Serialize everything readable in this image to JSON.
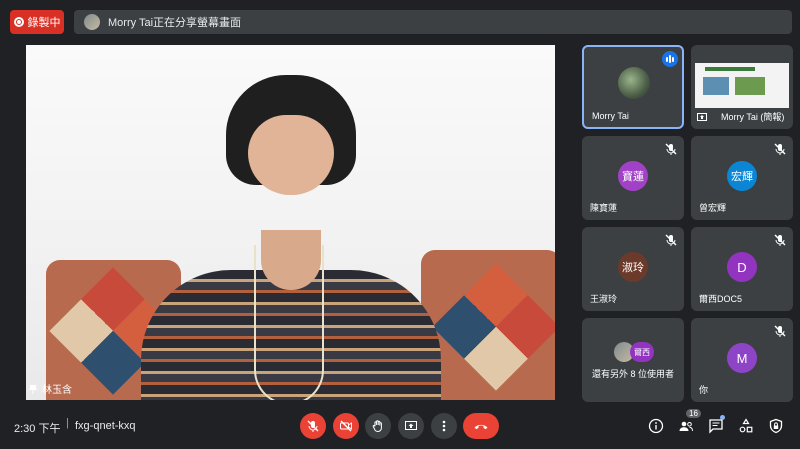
{
  "top_bar": {
    "recording_label": "錄製中",
    "share_text": "Morry Tai正在分享螢幕畫面"
  },
  "main_video": {
    "label": "林玉含"
  },
  "participants": [
    {
      "name": "Morry Tai",
      "kind": "video",
      "speaking": true
    },
    {
      "name": "Morry Tai (簡報)",
      "kind": "screen"
    },
    {
      "name": "陳寶蓮",
      "initial": "寶蓮",
      "color": "#a142c6",
      "muted": true
    },
    {
      "name": "曾宏輝",
      "initial": "宏輝",
      "color": "#0a86d4",
      "muted": true
    },
    {
      "name": "王淑玲",
      "initial": "淑玲",
      "color": "#6b3a2b",
      "muted": true
    },
    {
      "name": "爾西DOC5",
      "initial": "D",
      "color": "#9334c1",
      "muted": true
    },
    {
      "name": "還有另外 8 位使用者",
      "extra_badge": "爾西"
    },
    {
      "name": "你",
      "initial": "M",
      "color": "#8e44c7",
      "muted": true
    }
  ],
  "bottom_bar": {
    "time": "2:30 下午",
    "separator": "|",
    "meeting_code": "fxg-qnet-kxq",
    "participant_count": "16"
  },
  "colors": {
    "accent_red": "#ea4335",
    "tile_bg": "#3c4043",
    "background": "#202124",
    "active_border": "#8ab4f8"
  }
}
